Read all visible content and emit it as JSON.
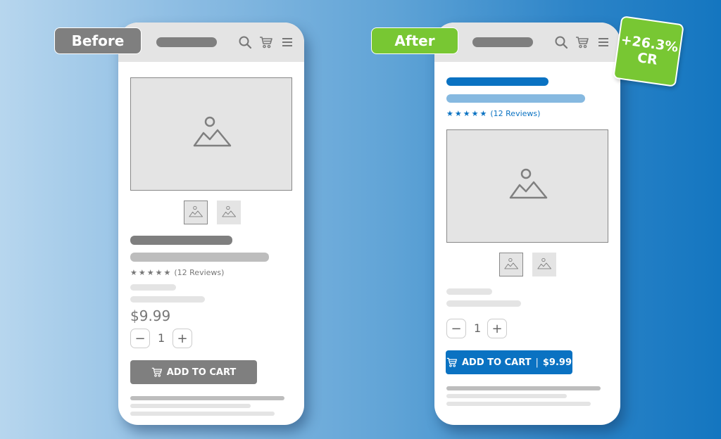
{
  "before": {
    "label": "Before",
    "review_text": "(12 Reviews)",
    "price": "$9.99",
    "quantity": "1",
    "minus": "−",
    "plus": "+",
    "cta_label": "ADD TO CART",
    "stars": [
      "★",
      "★",
      "★",
      "★",
      "★"
    ],
    "label_color": "#7f7f7f",
    "cta_color": "#7f7f7f"
  },
  "after": {
    "label": "After",
    "review_text": "(12 Reviews)",
    "quantity": "1",
    "minus": "−",
    "plus": "+",
    "cta_label": "ADD TO CART",
    "cta_separator": "|",
    "cta_price": "$9.99",
    "stars": [
      "★",
      "★",
      "★",
      "★",
      "★"
    ],
    "label_color": "#78c733",
    "cta_color": "#0a72c2"
  },
  "badge": {
    "line1": "+26.3%",
    "line2": "CR"
  },
  "icons": [
    "search-icon",
    "cart-icon",
    "menu-icon",
    "image-placeholder-icon"
  ]
}
